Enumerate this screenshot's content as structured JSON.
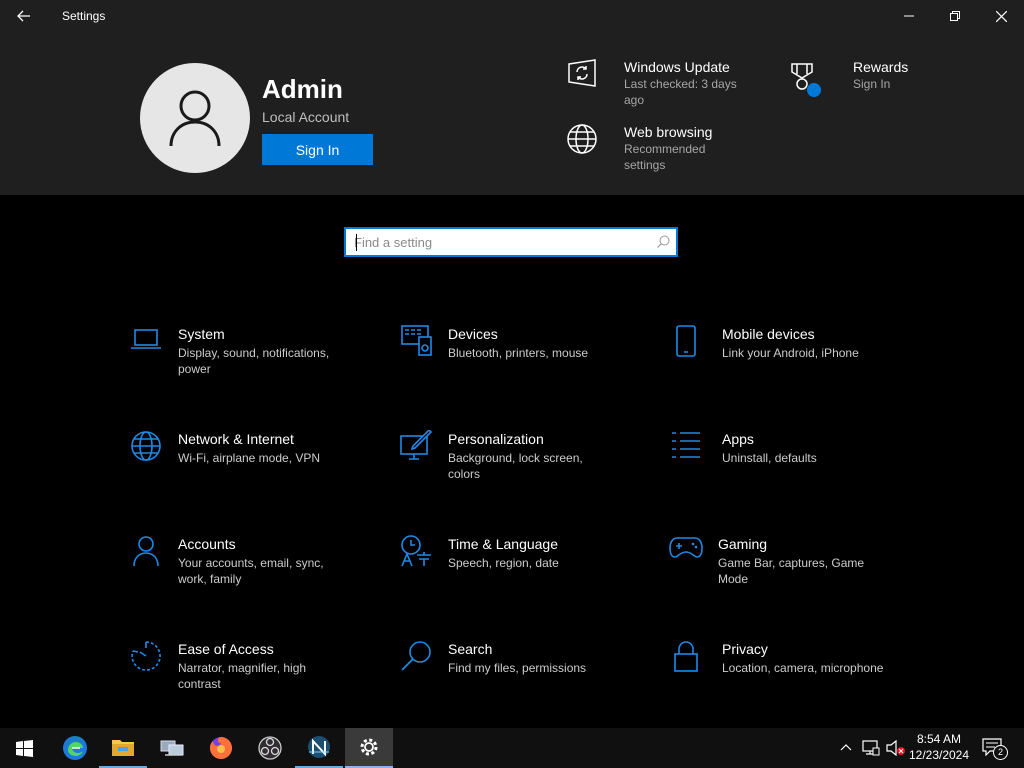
{
  "window": {
    "title": "Settings"
  },
  "header": {
    "user_name": "Admin",
    "account_type": "Local Account",
    "sign_in_label": "Sign In",
    "cards": [
      {
        "title": "Windows Update",
        "sub": "Last checked: 3 days ago",
        "icon": "windows-update-icon"
      },
      {
        "title": "Rewards",
        "sub": "Sign In",
        "icon": "rewards-icon"
      },
      {
        "title": "Web browsing",
        "sub": "Recommended settings",
        "icon": "globe-icon"
      }
    ]
  },
  "search": {
    "placeholder": "Find a setting",
    "value": ""
  },
  "categories": [
    {
      "title": "System",
      "sub": "Display, sound, notifications, power",
      "icon": "laptop-icon"
    },
    {
      "title": "Devices",
      "sub": "Bluetooth, printers, mouse",
      "icon": "devices-icon"
    },
    {
      "title": "Mobile devices",
      "sub": "Link your Android, iPhone",
      "icon": "phone-icon"
    },
    {
      "title": "Network & Internet",
      "sub": "Wi-Fi, airplane mode, VPN",
      "icon": "globe-icon"
    },
    {
      "title": "Personalization",
      "sub": "Background, lock screen, colors",
      "icon": "personalization-icon"
    },
    {
      "title": "Apps",
      "sub": "Uninstall, defaults",
      "icon": "apps-list-icon"
    },
    {
      "title": "Accounts",
      "sub": "Your accounts, email, sync, work, family",
      "icon": "person-icon"
    },
    {
      "title": "Time & Language",
      "sub": "Speech, region, date",
      "icon": "time-language-icon"
    },
    {
      "title": "Gaming",
      "sub": "Game Bar, captures, Game Mode",
      "icon": "gamepad-icon"
    },
    {
      "title": "Ease of Access",
      "sub": "Narrator, magnifier, high contrast",
      "icon": "ease-of-access-icon"
    },
    {
      "title": "Search",
      "sub": "Find my files, permissions",
      "icon": "search-icon"
    },
    {
      "title": "Privacy",
      "sub": "Location, camera, microphone",
      "icon": "lock-icon"
    }
  ],
  "taskbar": {
    "apps": [
      "start-icon",
      "edge-icon",
      "file-explorer-icon",
      "network-app-icon",
      "firefox-icon",
      "obs-icon",
      "app-icon",
      "settings-gear-icon"
    ],
    "time": "8:54 AM",
    "date": "12/23/2024",
    "notification_count": "2"
  },
  "colors": {
    "accent": "#0078d7",
    "header_bg": "#1f1f1f",
    "body_bg": "#000000"
  }
}
